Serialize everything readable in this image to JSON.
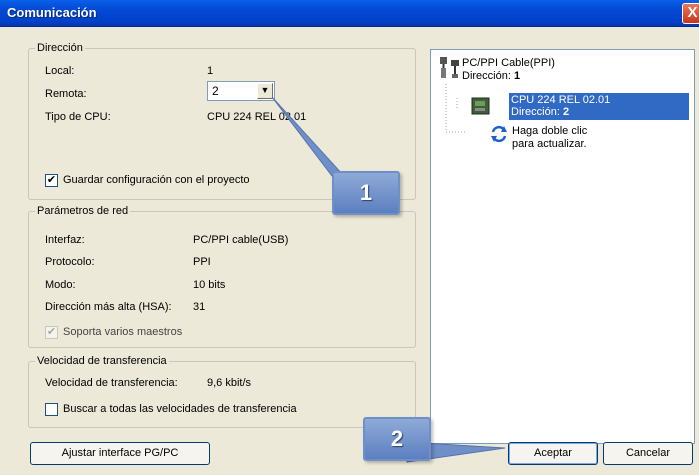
{
  "window": {
    "title": "Comunicación",
    "close_glyph": "X"
  },
  "direccion": {
    "legend": "Dirección",
    "local_label": "Local:",
    "local_value": "1",
    "remota_label": "Remota:",
    "remota_value": "2",
    "cpu_label": "Tipo de CPU:",
    "cpu_value": "CPU 224 REL 02.01",
    "guardar_label": "Guardar configuración con el proyecto",
    "guardar_checked": true
  },
  "red": {
    "legend": "Parámetros de red",
    "interfaz_label": "Interfaz:",
    "interfaz_value": "PC/PPI cable(USB)",
    "protocolo_label": "Protocolo:",
    "protocolo_value": "PPI",
    "modo_label": "Modo:",
    "modo_value": "10 bits",
    "hsa_label": "Dirección más alta (HSA):",
    "hsa_value": "31",
    "maestros_label": "Soporta varios maestros",
    "maestros_checked": true
  },
  "velocidad": {
    "legend": "Velocidad de transferencia",
    "rate_label": "Velocidad de transferencia:",
    "rate_value": "9,6 kbit/s",
    "buscar_label": "Buscar a todas las velocidades de transferencia",
    "buscar_checked": false
  },
  "tree": {
    "cable_name": "PC/PPI Cable(PPI)",
    "cable_addr_label": "Dirección:",
    "cable_addr_value": "1",
    "cpu_name": "CPU 224 REL 02.01",
    "cpu_addr_label": "Dirección:",
    "cpu_addr_value": "2",
    "refresh_line1": "Haga doble clic",
    "refresh_line2": "para actualizar."
  },
  "buttons": {
    "ajustar": "Ajustar interface PG/PC",
    "aceptar": "Aceptar",
    "cancelar": "Cancelar"
  },
  "callouts": {
    "one": "1",
    "two": "2"
  },
  "colors": {
    "accent": "#316ac5",
    "titlebar": "#0348d3",
    "badge": "#6f8fc8"
  }
}
